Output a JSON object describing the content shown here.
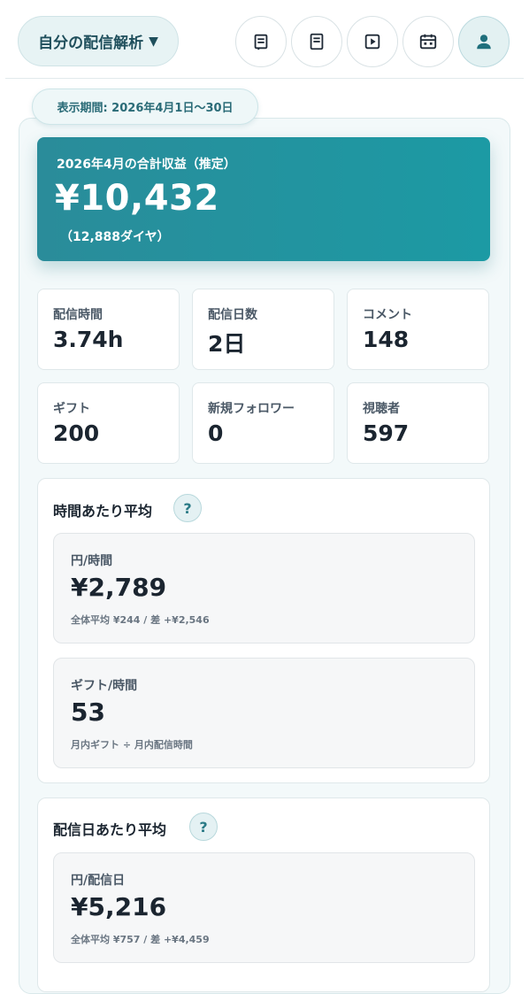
{
  "header": {
    "title": "自分の配信解析",
    "caret": "▼",
    "nav_icons": [
      "list-icon",
      "document-icon",
      "play-icon",
      "calendar-icon",
      "user-icon"
    ],
    "active_icon": "user-icon"
  },
  "period": {
    "label": "表示期間: 2026年4月1日〜30日"
  },
  "hero": {
    "label": "2026年4月の合計収益（推定）",
    "amount": "¥10,432",
    "sub": "（12,888ダイヤ）"
  },
  "stats": [
    {
      "label": "配信時間",
      "value": "3.74h"
    },
    {
      "label": "配信日数",
      "value": "2日"
    },
    {
      "label": "コメント",
      "value": "148"
    },
    {
      "label": "ギフト",
      "value": "200"
    },
    {
      "label": "新規フォロワー",
      "value": "0"
    },
    {
      "label": "視聴者",
      "value": "597"
    }
  ],
  "per_hour": {
    "title": "時間あたり平均",
    "help": "?",
    "metrics": [
      {
        "label": "円/時間",
        "value": "¥2,789",
        "note": "全体平均 ¥244 / 差 +¥2,546"
      },
      {
        "label": "ギフト/時間",
        "value": "53",
        "note": "月内ギフト ÷ 月内配信時間"
      }
    ]
  },
  "per_day": {
    "title": "配信日あたり平均",
    "help": "?",
    "metrics": [
      {
        "label": "円/配信日",
        "value": "¥5,216",
        "note": "全体平均 ¥757 / 差 +¥4,459"
      }
    ]
  },
  "colors": {
    "accent": "#1c9aa4",
    "hero_start": "#2a8c9a",
    "panel_bg": "#f3f9fa"
  }
}
